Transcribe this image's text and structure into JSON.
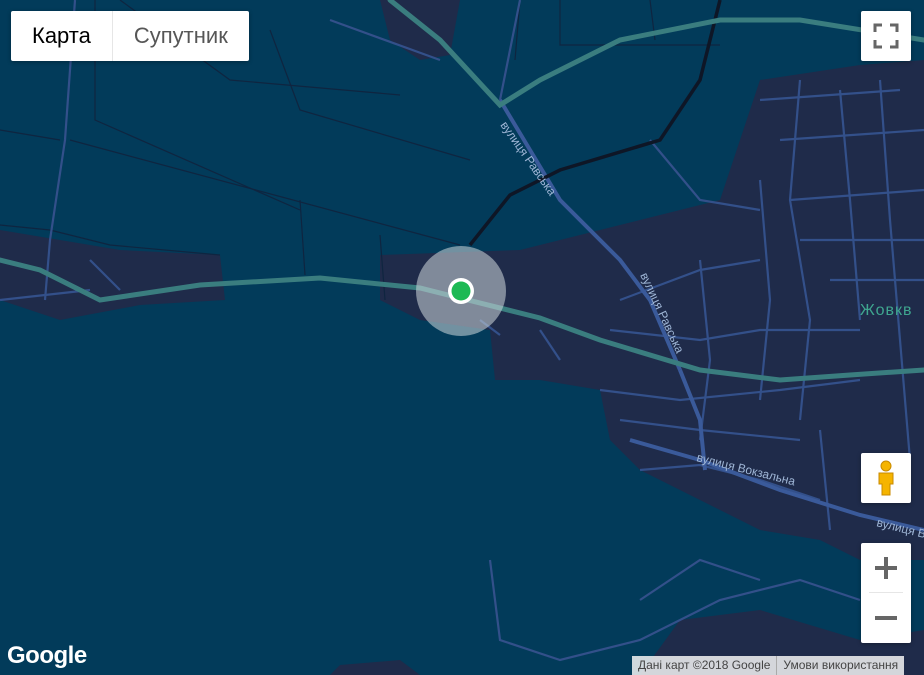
{
  "map_type": {
    "map_label": "Карта",
    "satellite_label": "Супутник",
    "active": "map"
  },
  "labels": {
    "street_ravska": "вулиця Равська",
    "street_vokzalna": "вулиця Вокзальна",
    "street_partial": "вулиця В",
    "town": "Жовкв"
  },
  "controls": {
    "fullscreen_icon": "fullscreen-icon",
    "pegman_icon": "pegman-icon",
    "zoom_in_icon": "plus-icon",
    "zoom_out_icon": "minus-icon"
  },
  "branding": {
    "logo": "Google"
  },
  "attribution": {
    "data": "Дані карт ©2018 Google",
    "terms": "Умови використання"
  },
  "colors": {
    "water_bg": "#023b5a",
    "urban": "#1f2b4a",
    "road": "#33508a",
    "highway": "#3a7d7f",
    "rail": "#0e1626",
    "marker": "#1db954",
    "town_label": "#3fa68f"
  }
}
